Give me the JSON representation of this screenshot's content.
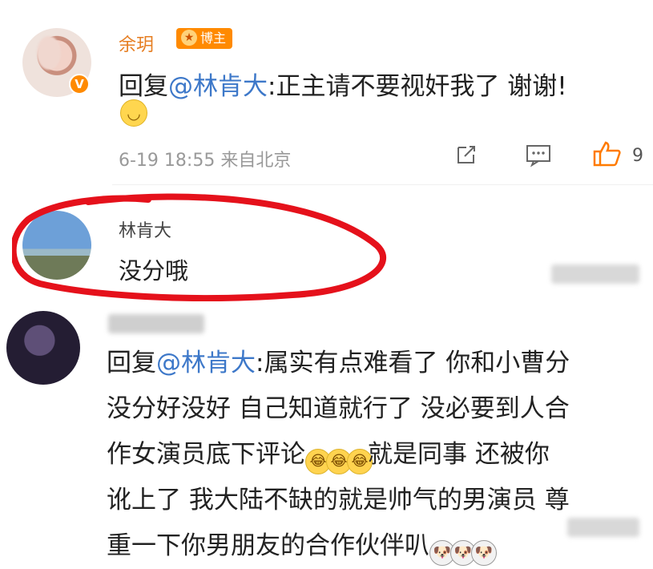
{
  "comments": [
    {
      "name": "余玥",
      "badge": "博主",
      "prefix": "回复",
      "mention": "@林肯大",
      "text": ":正主请不要视奸我了 谢谢!",
      "timestamp": "6-19 18:55 来自北京",
      "likes": "9"
    },
    {
      "name": "林肯大",
      "text": "没分哦"
    },
    {
      "prefix": "回复",
      "mention": "@林肯大",
      "line1": ":属实有点难看了 你和小曹分",
      "line2": "没分好没好 自己知道就行了 没必要到人合",
      "line3a": "作女演员底下评论",
      "line3b": "就是同事 还被你",
      "line4": "讹上了 我大陆不缺的就是帅气的男演员 尊",
      "line5": "重一下你男朋友的合作伙伴叭"
    }
  ]
}
